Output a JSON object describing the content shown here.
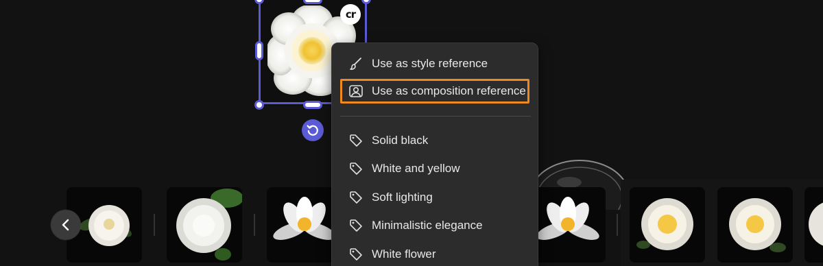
{
  "canvas": {
    "badge_text": "cr",
    "accent_color": "#5b5bd6",
    "highlight_color": "#f0891e"
  },
  "context_menu": {
    "actions": [
      {
        "label": "Use as style reference",
        "icon": "brush-icon"
      },
      {
        "label": "Use as composition reference",
        "icon": "composition-icon"
      }
    ],
    "tags": [
      {
        "label": "Solid black",
        "icon": "tag-icon"
      },
      {
        "label": "White and yellow",
        "icon": "tag-icon"
      },
      {
        "label": "Soft lighting",
        "icon": "tag-icon"
      },
      {
        "label": "Minimalistic elegance",
        "icon": "tag-icon"
      },
      {
        "label": "White flower",
        "icon": "tag-icon"
      }
    ]
  },
  "thumbnail_strip": {
    "prev_icon": "chevron-left-icon",
    "thumbnails": [
      {
        "subject": "white camellia with leaves"
      },
      {
        "subject": "white camellia bud with leaves"
      },
      {
        "subject": "white lotus"
      },
      {
        "subject": "white lotus"
      },
      {
        "subject": "white camellia with yellow center"
      },
      {
        "subject": "white camellia with yellow center"
      },
      {
        "subject": "white camellia partial"
      }
    ]
  }
}
